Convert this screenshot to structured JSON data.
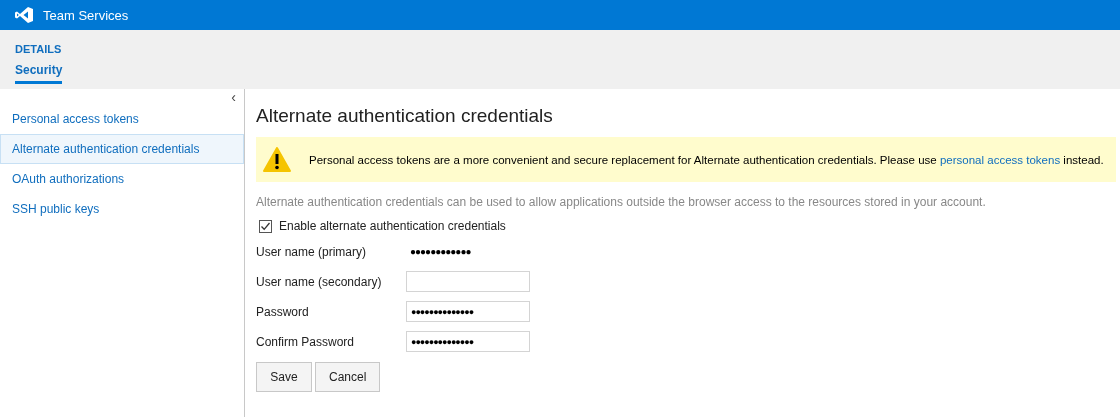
{
  "header": {
    "title": "Team Services"
  },
  "breadcrumb": {
    "section": "DETAILS",
    "tabs": [
      {
        "label": "Security",
        "selected": true
      }
    ]
  },
  "sidebar": {
    "collapse_glyph": "‹",
    "items": [
      {
        "label": "Personal access tokens",
        "selected": false
      },
      {
        "label": "Alternate authentication credentials",
        "selected": true
      },
      {
        "label": "OAuth authorizations",
        "selected": false
      },
      {
        "label": "SSH public keys",
        "selected": false
      }
    ]
  },
  "main": {
    "title": "Alternate authentication credentials",
    "warning": {
      "text_before": "Personal access tokens are a more convenient and secure replacement for Alternate authentication credentials. Please use ",
      "link": "personal access tokens",
      "text_after": " instead."
    },
    "description": "Alternate authentication credentials can be used to allow applications outside the browser access to the resources stored in your account.",
    "enable_checkbox": {
      "label": "Enable alternate authentication credentials",
      "checked": true
    },
    "fields": [
      {
        "label": "User name (primary)",
        "kind": "static",
        "value": "●●●●●●●●●●●●"
      },
      {
        "label": "User name (secondary)",
        "kind": "input"
      },
      {
        "label": "Password",
        "kind": "input",
        "value": "●●●●●●●●●●●●●●"
      },
      {
        "label": "Confirm Password",
        "kind": "input",
        "value": "●●●●●●●●●●●●●●"
      }
    ],
    "buttons": [
      "Save",
      "Cancel"
    ]
  }
}
